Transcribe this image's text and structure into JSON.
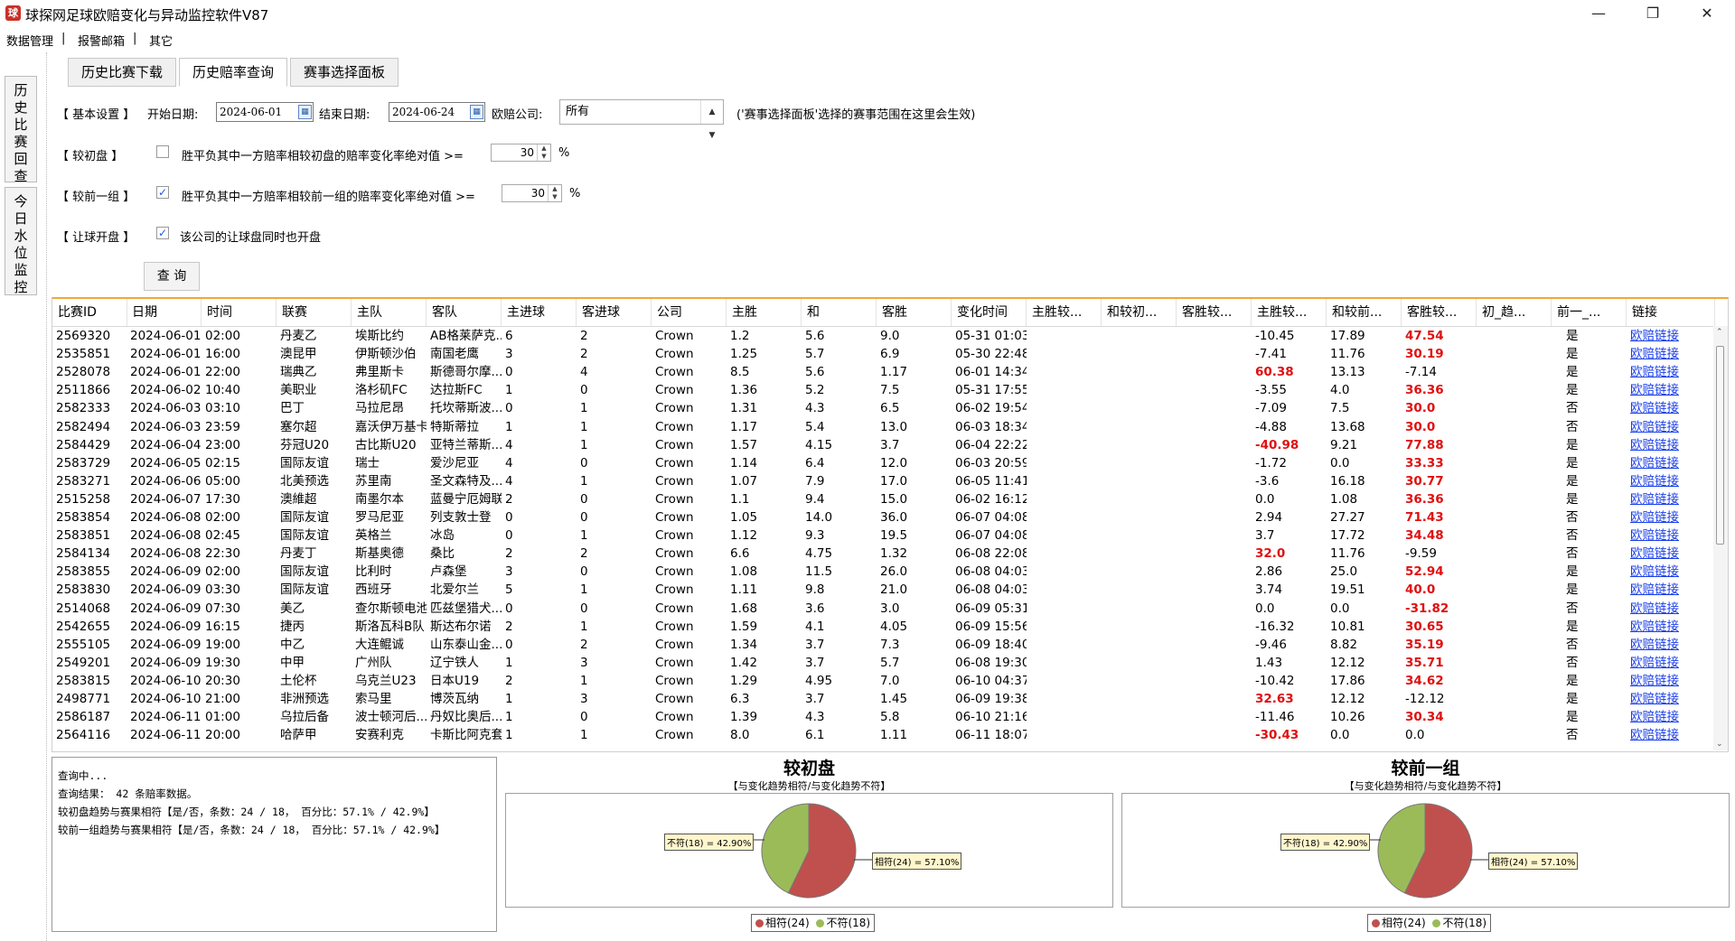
{
  "window": {
    "title": "球探网足球欧赔变化与异动监控软件V87"
  },
  "menu": [
    "数据管理",
    "报警邮箱",
    "其它"
  ],
  "menu_sep": "|",
  "side_tabs": [
    {
      "chars": [
        "历",
        "史",
        "比",
        "赛",
        "回",
        "查"
      ]
    },
    {
      "chars": [
        "今",
        "日",
        "水",
        "位",
        "监",
        "控"
      ]
    }
  ],
  "tabs": [
    "历史比赛下载",
    "历史赔率查询",
    "赛事选择面板"
  ],
  "settings": {
    "basic_label": "【 基本设置 】",
    "start_label": "开始日期:",
    "start_date": "2024-06-01",
    "end_label": "结束日期:",
    "end_date": "2024-06-24",
    "company_label": "欧赔公司:",
    "company_value": "所有",
    "note": "('赛事选择面板'选择的赛事范围在这里会生效)",
    "opening_label": "【   较初盘   】",
    "opening_checked": false,
    "opening_text": "胜平负其中一方赔率相较初盘的赔率变化率绝对值 >=",
    "opening_value": "30",
    "percent": "%",
    "prev_label": "【 较前一组 】",
    "prev_checked": true,
    "prev_text": "胜平负其中一方赔率相较前一组的赔率变化率绝对值 >=",
    "prev_value": "30",
    "handicap_label": "【 让球开盘 】",
    "handicap_checked": true,
    "handicap_text": "该公司的让球盘同时也开盘",
    "query_button": "查 询",
    "check_mark": "✓"
  },
  "table": {
    "headers": [
      "比赛ID",
      "日期",
      "时间",
      "联赛",
      "主队",
      "客队",
      "主进球",
      "客进球",
      "公司",
      "主胜",
      "和",
      "客胜",
      "变化时间",
      "主胜较...",
      "和较初...",
      "客胜较...",
      "主胜较...",
      "和较前...",
      "客胜较...",
      "初_趋...",
      "前一_...",
      "链接"
    ],
    "rows": [
      [
        "2569320",
        "2024-06-01",
        "02:00",
        "丹麦乙",
        "埃斯比约",
        "AB格莱萨克...",
        "6",
        "2",
        "Crown",
        "1.2",
        "5.6",
        "9.0",
        "05-31 01:03",
        "",
        "",
        "",
        "-10.45",
        "17.89",
        "47.54",
        "",
        "是",
        "欧赔链接"
      ],
      [
        "2535851",
        "2024-06-01",
        "16:00",
        "澳昆甲",
        "伊斯顿沙伯",
        "南国老鹰",
        "3",
        "2",
        "Crown",
        "1.25",
        "5.7",
        "6.9",
        "05-30 22:48",
        "",
        "",
        "",
        "-7.41",
        "11.76",
        "30.19",
        "",
        "是",
        "欧赔链接"
      ],
      [
        "2528078",
        "2024-06-01",
        "22:00",
        "瑞典乙",
        "弗里斯卡",
        "斯德哥尔摩...",
        "0",
        "4",
        "Crown",
        "8.5",
        "5.6",
        "1.17",
        "06-01 14:34",
        "",
        "",
        "",
        "60.38",
        "13.13",
        "-7.14",
        "",
        "是",
        "欧赔链接"
      ],
      [
        "2511866",
        "2024-06-02",
        "10:40",
        "美职业",
        "洛杉矶FC",
        "达拉斯FC",
        "1",
        "0",
        "Crown",
        "1.36",
        "5.2",
        "7.5",
        "05-31 17:55",
        "",
        "",
        "",
        "-3.55",
        "4.0",
        "36.36",
        "",
        "是",
        "欧赔链接"
      ],
      [
        "2582333",
        "2024-06-03",
        "03:10",
        "巴丁",
        "马拉尼昂",
        "托坎蒂斯波...",
        "0",
        "1",
        "Crown",
        "1.31",
        "4.3",
        "6.5",
        "06-02 19:54",
        "",
        "",
        "",
        "-7.09",
        "7.5",
        "30.0",
        "",
        "否",
        "欧赔链接"
      ],
      [
        "2582494",
        "2024-06-03",
        "23:59",
        "塞尔超",
        "嘉沃伊万基卡",
        "特斯蒂拉",
        "1",
        "1",
        "Crown",
        "1.17",
        "5.4",
        "13.0",
        "06-03 18:34",
        "",
        "",
        "",
        "-4.88",
        "13.68",
        "30.0",
        "",
        "否",
        "欧赔链接"
      ],
      [
        "2584429",
        "2024-06-04",
        "23:00",
        "芬冠U20",
        "古比斯U20",
        "亚特兰蒂斯...",
        "4",
        "1",
        "Crown",
        "1.57",
        "4.15",
        "3.7",
        "06-04 22:22",
        "",
        "",
        "",
        "-40.98",
        "9.21",
        "77.88",
        "",
        "是",
        "欧赔链接"
      ],
      [
        "2583729",
        "2024-06-05",
        "02:15",
        "国际友谊",
        "瑞士",
        "爱沙尼亚",
        "4",
        "0",
        "Crown",
        "1.14",
        "6.4",
        "12.0",
        "06-03 20:59",
        "",
        "",
        "",
        "-1.72",
        "0.0",
        "33.33",
        "",
        "是",
        "欧赔链接"
      ],
      [
        "2583271",
        "2024-06-06",
        "05:00",
        "北美预选",
        "苏里南",
        "圣文森特及...",
        "4",
        "1",
        "Crown",
        "1.07",
        "7.9",
        "17.0",
        "06-05 11:41",
        "",
        "",
        "",
        "-3.6",
        "16.18",
        "30.77",
        "",
        "是",
        "欧赔链接"
      ],
      [
        "2515258",
        "2024-06-07",
        "17:30",
        "澳維超",
        "南墨尔本",
        "蓝曼宁厄姆联",
        "2",
        "0",
        "Crown",
        "1.1",
        "9.4",
        "15.0",
        "06-02 16:12",
        "",
        "",
        "",
        "0.0",
        "1.08",
        "36.36",
        "",
        "是",
        "欧赔链接"
      ],
      [
        "2583854",
        "2024-06-08",
        "02:00",
        "国际友谊",
        "罗马尼亚",
        "列支敦士登",
        "0",
        "0",
        "Crown",
        "1.05",
        "14.0",
        "36.0",
        "06-07 04:08",
        "",
        "",
        "",
        "2.94",
        "27.27",
        "71.43",
        "",
        "否",
        "欧赔链接"
      ],
      [
        "2583851",
        "2024-06-08",
        "02:45",
        "国际友谊",
        "英格兰",
        "冰岛",
        "0",
        "1",
        "Crown",
        "1.12",
        "9.3",
        "19.5",
        "06-07 04:08",
        "",
        "",
        "",
        "3.7",
        "17.72",
        "34.48",
        "",
        "否",
        "欧赔链接"
      ],
      [
        "2584134",
        "2024-06-08",
        "22:30",
        "丹麦丁",
        "斯基奥德",
        "桑比",
        "2",
        "2",
        "Crown",
        "6.6",
        "4.75",
        "1.32",
        "06-08 22:08",
        "",
        "",
        "",
        "32.0",
        "11.76",
        "-9.59",
        "",
        "否",
        "欧赔链接"
      ],
      [
        "2583855",
        "2024-06-09",
        "02:00",
        "国际友谊",
        "比利时",
        "卢森堡",
        "3",
        "0",
        "Crown",
        "1.08",
        "11.5",
        "26.0",
        "06-08 04:03",
        "",
        "",
        "",
        "2.86",
        "25.0",
        "52.94",
        "",
        "是",
        "欧赔链接"
      ],
      [
        "2583830",
        "2024-06-09",
        "03:30",
        "国际友谊",
        "西班牙",
        "北爱尔兰",
        "5",
        "1",
        "Crown",
        "1.11",
        "9.8",
        "21.0",
        "06-08 04:03",
        "",
        "",
        "",
        "3.74",
        "19.51",
        "40.0",
        "",
        "是",
        "欧赔链接"
      ],
      [
        "2514068",
        "2024-06-09",
        "07:30",
        "美乙",
        "查尔斯顿电池",
        "匹兹堡猎犬...",
        "0",
        "0",
        "Crown",
        "1.68",
        "3.6",
        "3.0",
        "06-09 05:31",
        "",
        "",
        "",
        "0.0",
        "0.0",
        "-31.82",
        "",
        "否",
        "欧赔链接"
      ],
      [
        "2542655",
        "2024-06-09",
        "16:15",
        "捷丙",
        "斯洛瓦科B队",
        "斯达布尔诺",
        "2",
        "1",
        "Crown",
        "1.59",
        "4.1",
        "4.05",
        "06-09 15:56",
        "",
        "",
        "",
        "-16.32",
        "10.81",
        "30.65",
        "",
        "是",
        "欧赔链接"
      ],
      [
        "2555105",
        "2024-06-09",
        "19:00",
        "中乙",
        "大连鲲诚",
        "山东泰山金...",
        "0",
        "2",
        "Crown",
        "1.34",
        "3.7",
        "7.3",
        "06-09 18:40",
        "",
        "",
        "",
        "-9.46",
        "8.82",
        "35.19",
        "",
        "否",
        "欧赔链接"
      ],
      [
        "2549201",
        "2024-06-09",
        "19:30",
        "中甲",
        "广州队",
        "辽宁铁人",
        "1",
        "3",
        "Crown",
        "1.42",
        "3.7",
        "5.7",
        "06-08 19:30",
        "",
        "",
        "",
        "1.43",
        "12.12",
        "35.71",
        "",
        "否",
        "欧赔链接"
      ],
      [
        "2583815",
        "2024-06-10",
        "20:30",
        "土伦杯",
        "乌克兰U23",
        "日本U19",
        "2",
        "1",
        "Crown",
        "1.29",
        "4.95",
        "7.0",
        "06-10 04:37",
        "",
        "",
        "",
        "-10.42",
        "17.86",
        "34.62",
        "",
        "是",
        "欧赔链接"
      ],
      [
        "2498771",
        "2024-06-10",
        "21:00",
        "非洲预选",
        "索马里",
        "博茨瓦纳",
        "1",
        "3",
        "Crown",
        "6.3",
        "3.7",
        "1.45",
        "06-09 19:38",
        "",
        "",
        "",
        "32.63",
        "12.12",
        "-12.12",
        "",
        "是",
        "欧赔链接"
      ],
      [
        "2586187",
        "2024-06-11",
        "01:00",
        "乌拉后备",
        "波士顿河后...",
        "丹奴比奥后...",
        "1",
        "0",
        "Crown",
        "1.39",
        "4.3",
        "5.8",
        "06-10 21:16",
        "",
        "",
        "",
        "-11.46",
        "10.26",
        "30.34",
        "",
        "是",
        "欧赔链接"
      ],
      [
        "2564116",
        "2024-06-11",
        "20:00",
        "哈萨甲",
        "安赛利克",
        "卡斯比阿克套",
        "1",
        "1",
        "Crown",
        "8.0",
        "6.1",
        "1.11",
        "06-11 18:07",
        "",
        "",
        "",
        "-30.43",
        "0.0",
        "0.0",
        "",
        "否",
        "欧赔链接"
      ]
    ]
  },
  "log": [
    "查询中...",
    "查询结果： 42 条赔率数据。",
    "较初盘趋势与赛果相符【是/否，条数：24 / 18， 百分比：57.1% / 42.9%】",
    "较前一组趋势与赛果相符【是/否，条数：24 / 18， 百分比：57.1% / 42.9%】"
  ],
  "charts": [
    {
      "title": "较初盘",
      "subtitle": "【与变化趋势相符/与变化趋势不符】",
      "label_yes": "相符(24) = 57.10%",
      "label_no": "不符(18) = 42.90%",
      "legend_yes": "相符(24)",
      "legend_no": "不符(18)"
    },
    {
      "title": "较前一组",
      "subtitle": "【与变化趋势相符/与变化趋势不符】",
      "label_yes": "相符(24) = 57.10%",
      "label_no": "不符(18) = 42.90%",
      "legend_yes": "相符(24)",
      "legend_no": "不符(18)"
    }
  ],
  "chart_data": [
    {
      "type": "pie",
      "title": "较初盘",
      "categories": [
        "相符",
        "不符"
      ],
      "values": [
        24,
        18
      ],
      "percent": [
        57.1,
        42.9
      ],
      "colors": [
        "#c0504d",
        "#9bbb59"
      ]
    },
    {
      "type": "pie",
      "title": "较前一组",
      "categories": [
        "相符",
        "不符"
      ],
      "values": [
        24,
        18
      ],
      "percent": [
        57.1,
        42.9
      ],
      "colors": [
        "#c0504d",
        "#9bbb59"
      ]
    }
  ],
  "colors": {
    "yes": "#c0504d",
    "no": "#9bbb59",
    "accent": "#f0a838",
    "link": "#1a3ee8",
    "highlight": "#e01010"
  }
}
